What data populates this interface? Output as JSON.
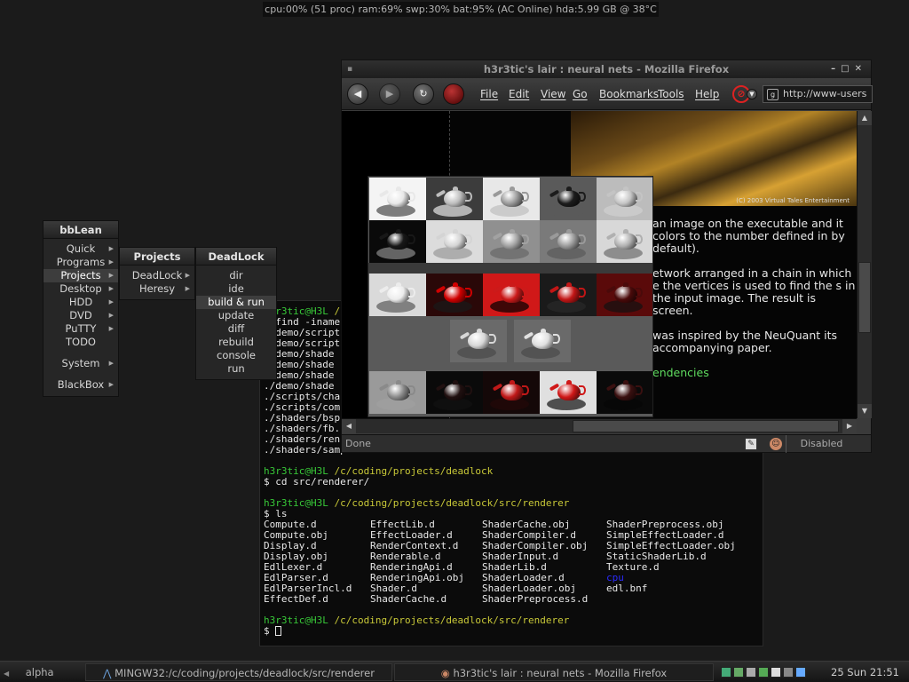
{
  "statusbar": {
    "text": "cpu:00% (51 proc) ram:69% swp:30% bat:95% (AC Online) hda:5.99 GB @ 38°C"
  },
  "bbmenu": {
    "title": "bbLean",
    "items": [
      "Quick",
      "Programs",
      "Projects",
      "Desktop",
      "HDD",
      "DVD",
      "PuTTY",
      "TODO",
      "System",
      "BlackBox"
    ],
    "submenus": [
      true,
      true,
      true,
      true,
      true,
      true,
      true,
      false,
      true,
      true
    ],
    "selected": 2
  },
  "projects_menu": {
    "title": "Projects",
    "items": [
      "DeadLock",
      "Heresy"
    ]
  },
  "deadlock_menu": {
    "title": "DeadLock",
    "items": [
      "dir",
      "ide",
      "build & run",
      "update",
      "diff",
      "rebuild",
      "console",
      "run"
    ],
    "selected": 2
  },
  "firefox": {
    "title": "h3r3tic's lair : neural nets - Mozilla Firefox",
    "menus": [
      "File",
      "Edit",
      "View",
      "Go",
      "Bookmarks",
      "Tools",
      "Help"
    ],
    "url": "http://www-users",
    "photo_caption": "(C) 2003 Virtual Tales Entertainment",
    "paragraphs": [
      "an image on the executable and it colors to the number defined in by default).",
      "etwork arranged in a chain in which e the vertices is used to find the s in the input image. The result is screen.",
      "was inspired by the NeuQuant its accompanying paper."
    ],
    "link": "endencies",
    "status": "Done",
    "status_right": "Disabled"
  },
  "terminal": {
    "prompt_user": "h3r3tic@H3L",
    "lines_top": [
      "$ find -iname",
      "./demo/script",
      "./demo/script",
      "./demo/shade",
      "./demo/shade",
      "./demo/shade",
      "./demo/shade",
      "./scripts/cha",
      "./scripts/com",
      "./shaders/bsp",
      "./shaders/fb.",
      "./shaders/ren",
      "./shaders/sampleShader.shader"
    ],
    "first_prompt_path": "/",
    "path1": "/c/coding/projects/deadlock",
    "cmd1": "$ cd src/renderer/",
    "path2": "/c/coding/projects/deadlock/src/renderer",
    "cmd2": "$ ls",
    "ls": [
      [
        "Compute.d",
        "EffectLib.d",
        "ShaderCache.obj",
        "ShaderPreprocess.obj"
      ],
      [
        "Compute.obj",
        "EffectLoader.d",
        "ShaderCompiler.d",
        "SimpleEffectLoader.d"
      ],
      [
        "Display.d",
        "RenderContext.d",
        "ShaderCompiler.obj",
        "SimpleEffectLoader.obj"
      ],
      [
        "Display.obj",
        "Renderable.d",
        "ShaderInput.d",
        "StaticShaderLib.d"
      ],
      [
        "EdlLexer.d",
        "RenderingApi.d",
        "ShaderLib.d",
        "Texture.d"
      ],
      [
        "EdlParser.d",
        "RenderingApi.obj",
        "ShaderLoader.d",
        "cpu"
      ],
      [
        "EdlParserIncl.d",
        "Shader.d",
        "ShaderLoader.obj",
        "edl.bnf"
      ],
      [
        "EffectDef.d",
        "ShaderCache.d",
        "ShaderPreprocess.d",
        ""
      ]
    ],
    "path3": "/c/coding/projects/deadlock/src/renderer",
    "cmd3": "$ "
  },
  "teapots": {
    "rows": [
      [
        [
          "#e8e8e8",
          "#4a4a4a"
        ],
        [
          "#bdbdbd",
          "#e6e6e6"
        ],
        [
          "#9a9a9a",
          "#bfbfbf"
        ],
        [
          "#1c1c1c",
          "#5a5a5a"
        ],
        [
          "#c4c4c4",
          "#d0d0d0"
        ]
      ],
      [
        [
          "#181818",
          "#8a8a8a"
        ],
        [
          "#d4d4d4",
          "#999"
        ],
        [
          "#a2a2a2",
          "#666"
        ],
        [
          "#9a9a9a",
          "#5a5a5a"
        ],
        [
          "#b0b0b0",
          "#6e6e6e"
        ]
      ],
      [
        [
          "#ececec",
          "#5a5a5a"
        ],
        [
          "#d00000",
          "#1a1a1a"
        ],
        [
          "#cc1a1a",
          "#000"
        ],
        [
          "#c21616",
          "#2a2a2a"
        ],
        [
          "#4a0a0a",
          "#111"
        ]
      ],
      [
        [
          "#d8d8d8",
          "#4a4a4a"
        ],
        [
          "#e0e0e0",
          "#4a4a4a"
        ]
      ],
      [
        [
          "#8a8a8a",
          "#a0a0a0"
        ],
        [
          "#201010",
          "#111"
        ],
        [
          "#c01818",
          "#240808"
        ],
        [
          "#d01818",
          "#111"
        ],
        [
          "#3a1010",
          "#050505"
        ]
      ]
    ]
  },
  "taskbar": {
    "workspace": "alpha",
    "task1": "MINGW32:/c/coding/projects/deadlock/src/renderer",
    "task2": "h3r3tic's lair : neural nets - Mozilla Firefox",
    "clock": "25 Sun 21:51"
  }
}
